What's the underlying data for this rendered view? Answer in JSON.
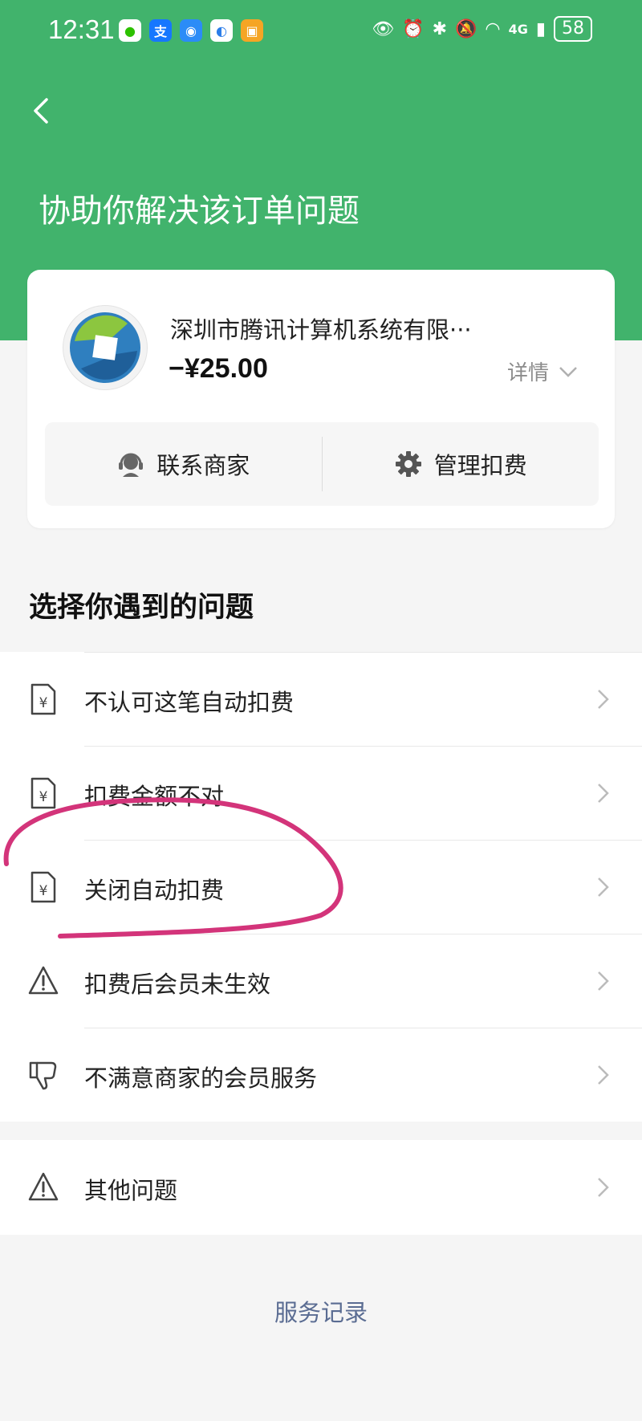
{
  "status_bar": {
    "time": "12:31",
    "app_icons": [
      "wechat-icon",
      "alipay-icon",
      "message-icon",
      "browser-icon",
      "app-icon"
    ],
    "signal_label": "4G",
    "battery": "58"
  },
  "header": {
    "title": "协助你解决该订单问题"
  },
  "order_card": {
    "merchant_name": "深圳市腾讯计算机系统有限···",
    "amount": "−¥25.00",
    "detail_label": "详情",
    "contact_label": "联系商家",
    "manage_label": "管理扣费"
  },
  "problems": {
    "title": "选择你遇到的问题",
    "items": [
      {
        "label": "不认可这笔自动扣费",
        "icon": "receipt-icon"
      },
      {
        "label": "扣费金额不对",
        "icon": "receipt-icon"
      },
      {
        "label": "关闭自动扣费",
        "icon": "receipt-icon"
      },
      {
        "label": "扣费后会员未生效",
        "icon": "warning-icon"
      },
      {
        "label": "不满意商家的会员服务",
        "icon": "thumbs-down-icon"
      }
    ],
    "other": {
      "label": "其他问题",
      "icon": "warning-icon"
    }
  },
  "footer": {
    "service_record": "服务记录"
  },
  "colors": {
    "brand_green": "#41b36c",
    "annotation": "#d3347a",
    "link": "#5a6c92"
  }
}
